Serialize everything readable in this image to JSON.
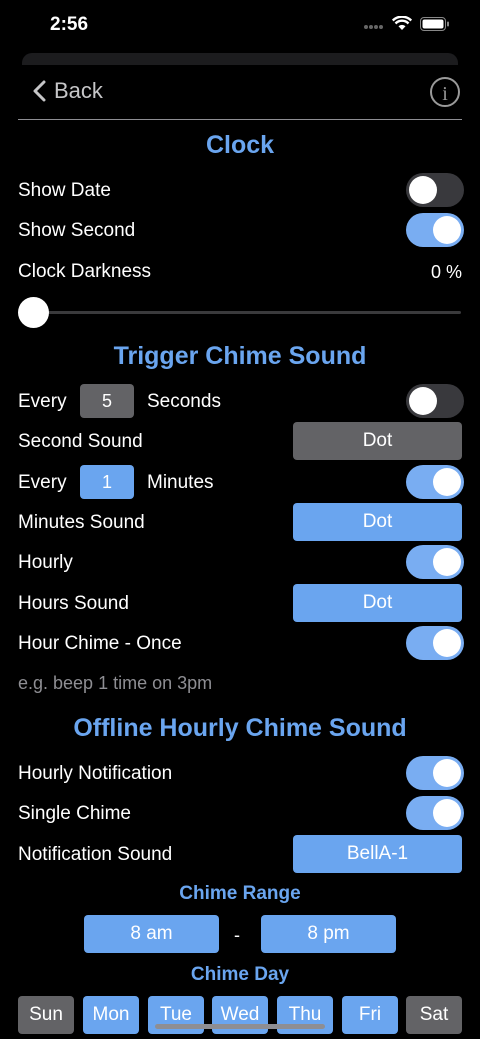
{
  "status": {
    "time": "2:56"
  },
  "nav": {
    "back_label": "Back",
    "info_label": "i"
  },
  "clock": {
    "title": "Clock",
    "show_date": {
      "label": "Show Date",
      "on": false
    },
    "show_second": {
      "label": "Show Second",
      "on": true
    },
    "darkness": {
      "label": "Clock Darkness",
      "value": "0 %",
      "level": 0
    }
  },
  "trigger": {
    "title": "Trigger Chime Sound",
    "every_seconds": {
      "prefix": "Every",
      "value": "5",
      "suffix": "Seconds",
      "on": false
    },
    "second_sound": {
      "label": "Second Sound",
      "value": "Dot"
    },
    "every_minutes": {
      "prefix": "Every",
      "value": "1",
      "suffix": "Minutes",
      "on": true
    },
    "minutes_sound": {
      "label": "Minutes Sound",
      "value": "Dot"
    },
    "hourly": {
      "label": "Hourly",
      "on": true
    },
    "hours_sound": {
      "label": "Hours Sound",
      "value": "Dot"
    },
    "hour_chime_once": {
      "label": "Hour Chime - Once",
      "on": true
    },
    "hint": "e.g. beep 1 time on 3pm"
  },
  "offline": {
    "title": "Offline Hourly Chime Sound",
    "hourly_notification": {
      "label": "Hourly Notification",
      "on": true
    },
    "single_chime": {
      "label": "Single Chime",
      "on": true
    },
    "notification_sound": {
      "label": "Notification Sound",
      "value": "BellA-1"
    },
    "chime_range_title": "Chime Range",
    "range_start": "8 am",
    "range_sep": "-",
    "range_end": "8 pm",
    "chime_day_title": "Chime Day",
    "days": [
      {
        "label": "Sun",
        "selected": false
      },
      {
        "label": "Mon",
        "selected": true
      },
      {
        "label": "Tue",
        "selected": true
      },
      {
        "label": "Wed",
        "selected": true
      },
      {
        "label": "Thu",
        "selected": true
      },
      {
        "label": "Fri",
        "selected": true
      },
      {
        "label": "Sat",
        "selected": false
      }
    ]
  },
  "colors": {
    "accent": "#6aa5ef",
    "toggle_on": "#79adf2",
    "toggle_off": "#39393d",
    "button_gray": "#636366"
  }
}
